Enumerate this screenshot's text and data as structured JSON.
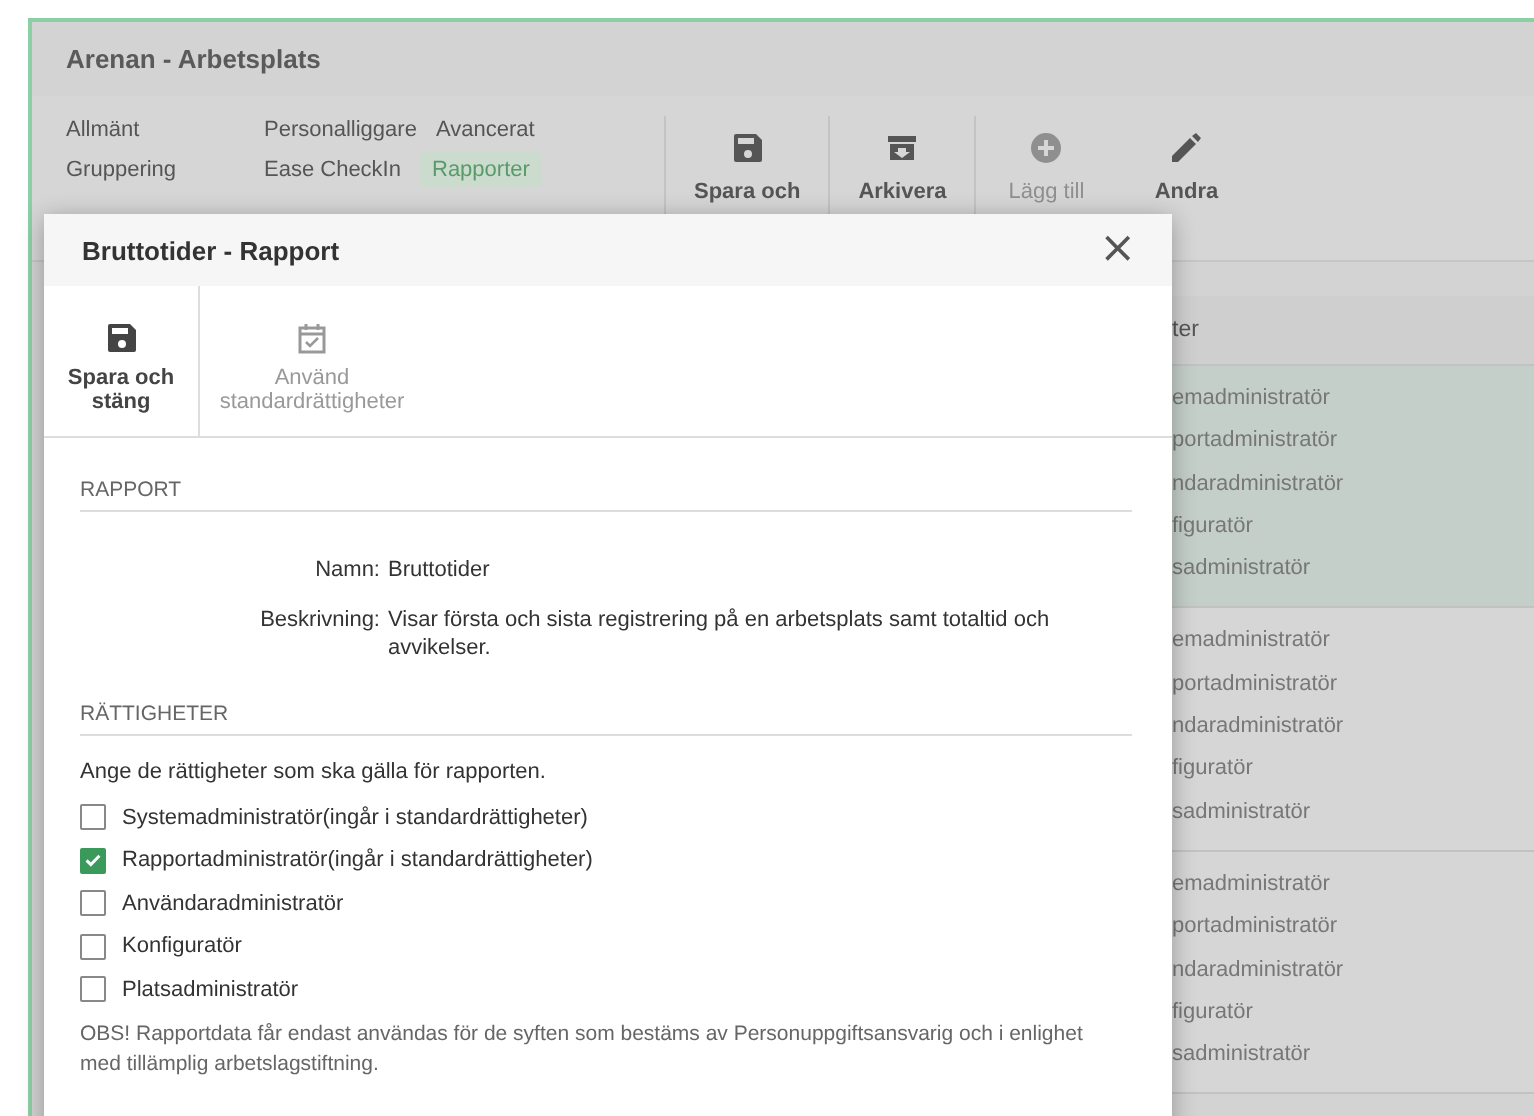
{
  "app": {
    "title": "Arenan - Arbetsplats"
  },
  "nav": {
    "columns": [
      [
        {
          "label": "Allmänt",
          "selected": false
        },
        {
          "label": "Gruppering",
          "selected": false
        }
      ],
      [
        {
          "label": "Personalliggare",
          "selected": false
        },
        {
          "label": "Ease CheckIn",
          "selected": false
        }
      ],
      [
        {
          "label": "Avancerat",
          "selected": false
        },
        {
          "label": "Rapporter",
          "selected": true
        }
      ]
    ]
  },
  "toolbar": [
    {
      "label": "Spara och",
      "kind": "save",
      "disabled": false
    },
    {
      "label": "Arkivera",
      "kind": "archive",
      "disabled": false
    },
    {
      "label": "Lägg till",
      "kind": "add",
      "disabled": true
    },
    {
      "label": "Andra",
      "kind": "pencil",
      "disabled": false
    }
  ],
  "list": {
    "header": "ter",
    "groups": [
      {
        "selected": true,
        "items": [
          "emadministratör",
          "portadministratör",
          "ndaradministratör",
          "figuratör",
          "sadministratör"
        ]
      },
      {
        "selected": false,
        "items": [
          "emadministratör",
          "portadministratör",
          "ndaradministratör",
          "figuratör",
          "sadministratör"
        ]
      },
      {
        "selected": false,
        "items": [
          "emadministratör",
          "portadministratör",
          "ndaradministratör",
          "figuratör",
          "sadministratör"
        ]
      }
    ]
  },
  "dialog": {
    "title": "Bruttotider - Rapport",
    "close": "×",
    "toolbar": [
      {
        "label": "Spara och stäng",
        "kind": "save",
        "disabled": false
      },
      {
        "label": "Använd standardrättigheter",
        "kind": "calendar-check",
        "disabled": true
      }
    ],
    "report_section": {
      "heading": "RAPPORT",
      "fields": [
        {
          "label": "Namn:",
          "value": "Bruttotider"
        },
        {
          "label": "Beskrivning:",
          "value": "Visar första och sista registrering på en arbetsplats samt totaltid och avvikelser."
        }
      ]
    },
    "rights_section": {
      "heading": "RÄTTIGHETER",
      "intro": "Ange de rättigheter som ska gälla för rapporten.",
      "options": [
        {
          "label": "Systemadministratör(ingår i standardrättigheter)",
          "checked": false
        },
        {
          "label": "Rapportadministratör(ingår i standardrättigheter)",
          "checked": true
        },
        {
          "label": "Användaradministratör",
          "checked": false
        },
        {
          "label": "Konfiguratör",
          "checked": false
        },
        {
          "label": "Platsadministratör",
          "checked": false
        }
      ],
      "note": "OBS! Rapportdata får endast användas för de syften som bestäms av Personuppgiftsansvarig och i enlighet med tillämplig arbetslagstiftning."
    }
  }
}
